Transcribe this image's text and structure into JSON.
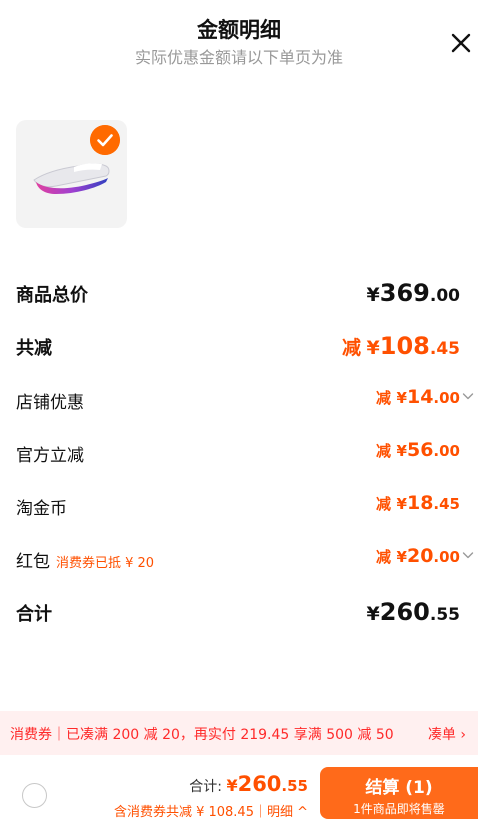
{
  "header": {
    "title": "金额明细",
    "subtitle": "实际优惠金额请以下单页为准",
    "close_icon": "close-icon"
  },
  "product": {
    "image_icon": "running-shoe-icon",
    "selected_icon": "checkmark-icon",
    "accent_color": "#ff6a00"
  },
  "rows": {
    "subtotal": {
      "label": "商品总价",
      "currency": "¥",
      "int": "369",
      "dec": ".00"
    },
    "total_discount": {
      "label": "共减",
      "prefix": "减",
      "currency": "¥",
      "int": "108",
      "dec": ".45"
    },
    "shop_discount": {
      "label": "店铺优惠",
      "prefix": "减",
      "currency": "¥",
      "int": "14",
      "dec": ".00"
    },
    "official_discount": {
      "label": "官方立减",
      "prefix": "减",
      "currency": "¥",
      "int": "56",
      "dec": ".00"
    },
    "taobao_coins": {
      "label": "淘金币",
      "prefix": "减",
      "currency": "¥",
      "int": "18",
      "dec": ".45"
    },
    "red_packet": {
      "label": "红包",
      "note": "消费券已抵 ¥ 20",
      "prefix": "减",
      "currency": "¥",
      "int": "20",
      "dec": ".00"
    },
    "total": {
      "label": "合计",
      "currency": "¥",
      "int": "260",
      "dec": ".55"
    }
  },
  "coupon_bar": {
    "text": "消费券｜已凑满 200 减 20，再实付 219.45 享满 500 减 50",
    "action": "凑单 ›",
    "bg_color": "#fff0f0",
    "text_color": "#ff2a2a"
  },
  "footer": {
    "total_label": "合计: ",
    "currency": "¥",
    "total_int": "260",
    "total_dec": ".55",
    "discount_summary": "含消费券共减 ¥ 108.45｜明细 ^",
    "checkout_label": "结算 (1)",
    "checkout_sub": "1件商品即将售罄",
    "checkout_color": "#ff6a1a"
  }
}
